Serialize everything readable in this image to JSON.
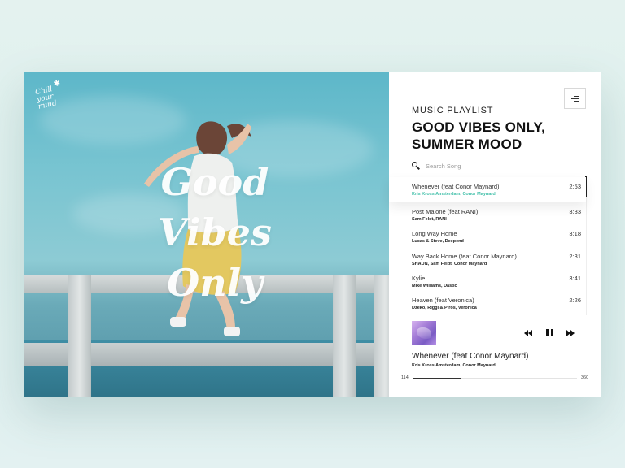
{
  "hero": {
    "logo_lines": [
      "Chill",
      "your",
      "mind"
    ],
    "overlay_lines": [
      "Good",
      "Vibes",
      "Only"
    ]
  },
  "playlist": {
    "subtitle": "MUSIC PLAYLIST",
    "title_line1": "GOOD VIBES ONLY,",
    "title_line2": "SUMMER MOOD",
    "search_placeholder": "Search Song",
    "songs": [
      {
        "title": "Whenever (feat Conor Maynard)",
        "artist": "Kris Kross Amsterdam, Conor Maynard",
        "duration": "2:53"
      },
      {
        "title": "Post Malone (feat RANI)",
        "artist": "Sam Feldt, RANI",
        "duration": "3:33"
      },
      {
        "title": "Long Way Home",
        "artist": "Lucas & Steve, Deepend",
        "duration": "3:18"
      },
      {
        "title": "Way Back Home (feat Conor Maynard)",
        "artist": "SHAUN, Sam Feldt, Conor Maynard",
        "duration": "2:31"
      },
      {
        "title": "Kylie",
        "artist": "Mike Williams, Dastic",
        "duration": "3:41"
      },
      {
        "title": "Heaven (feat Veronica)",
        "artist": "Dzeko, Riggi & Piros, Veronica",
        "duration": "2:26"
      }
    ]
  },
  "player": {
    "track_title": "Whenever (feat Conor Maynard)",
    "track_artist": "Kris Kross Amsterdam, Conor Maynard",
    "current_time": "114",
    "total_time": "360",
    "progress": 0.29
  },
  "colors": {
    "accent": "#3fbfa8",
    "sky": "#78c4d1"
  },
  "icons": [
    "menu-icon",
    "search-icon",
    "previous-icon",
    "pause-icon",
    "next-icon"
  ]
}
